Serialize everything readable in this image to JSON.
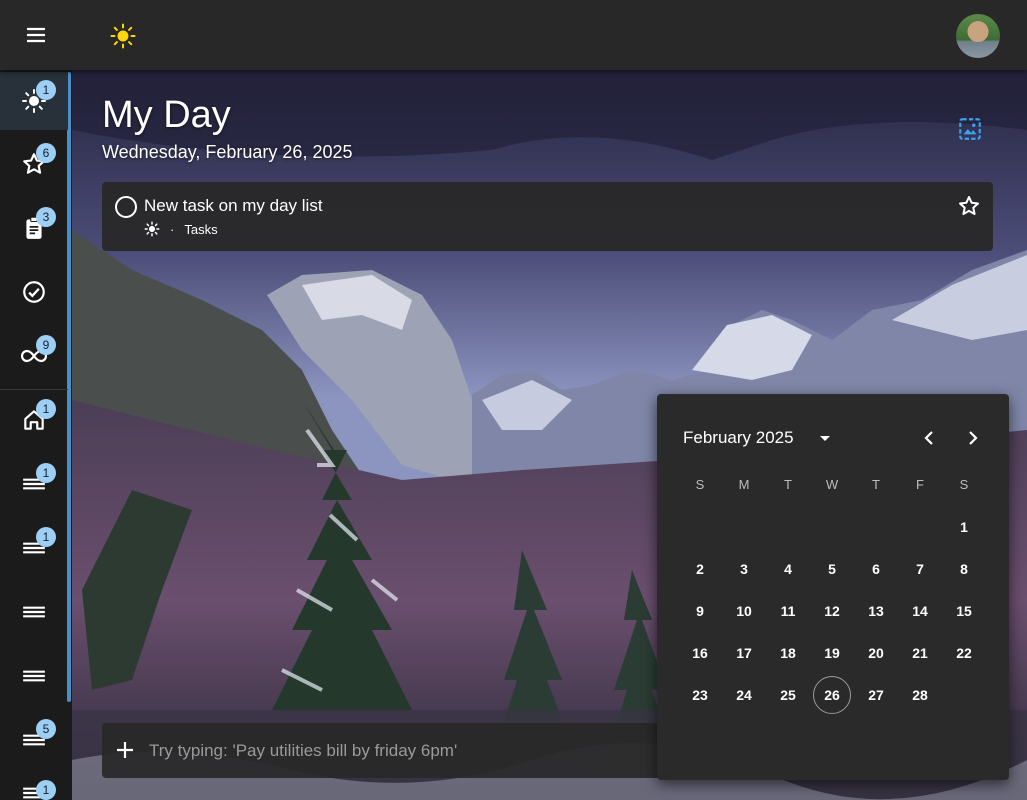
{
  "topbar": {
    "menu_icon": "menu-icon",
    "theme_icon": "sun-icon",
    "accent": "#ffd60a"
  },
  "sidebar": {
    "items": [
      {
        "icon": "sun-icon",
        "badge": "1",
        "active": true
      },
      {
        "icon": "star-icon",
        "badge": "6"
      },
      {
        "icon": "clipboard-icon",
        "badge": "3"
      },
      {
        "icon": "check-circle-icon",
        "badge": ""
      },
      {
        "icon": "infinity-icon",
        "badge": "9"
      },
      {
        "icon": "home-icon",
        "badge": "1"
      },
      {
        "icon": "list-icon",
        "badge": "1"
      },
      {
        "icon": "list-icon",
        "badge": "1"
      },
      {
        "icon": "list-icon",
        "badge": ""
      },
      {
        "icon": "list-icon",
        "badge": ""
      },
      {
        "icon": "list-icon",
        "badge": "5"
      },
      {
        "icon": "list-icon",
        "badge": "1"
      }
    ],
    "badge_color": "#9dcff5",
    "accent": "#4a90c8"
  },
  "main": {
    "title": "My Day",
    "date": "Wednesday, February 26, 2025",
    "background_icon": "image-icon"
  },
  "task": {
    "title": "New task on my day list",
    "meta_separator": "·",
    "list_name": "Tasks"
  },
  "add_task": {
    "placeholder": "Try typing: 'Pay utilities bill by friday 6pm'"
  },
  "calendar": {
    "month_label": "February 2025",
    "weekdays": [
      "S",
      "M",
      "T",
      "W",
      "T",
      "F",
      "S"
    ],
    "weeks": [
      [
        "",
        "",
        "",
        "",
        "",
        "",
        "1"
      ],
      [
        "2",
        "3",
        "4",
        "5",
        "6",
        "7",
        "8"
      ],
      [
        "9",
        "10",
        "11",
        "12",
        "13",
        "14",
        "15"
      ],
      [
        "16",
        "17",
        "18",
        "19",
        "20",
        "21",
        "22"
      ],
      [
        "23",
        "24",
        "25",
        "26",
        "27",
        "28",
        ""
      ]
    ],
    "today": "26"
  }
}
